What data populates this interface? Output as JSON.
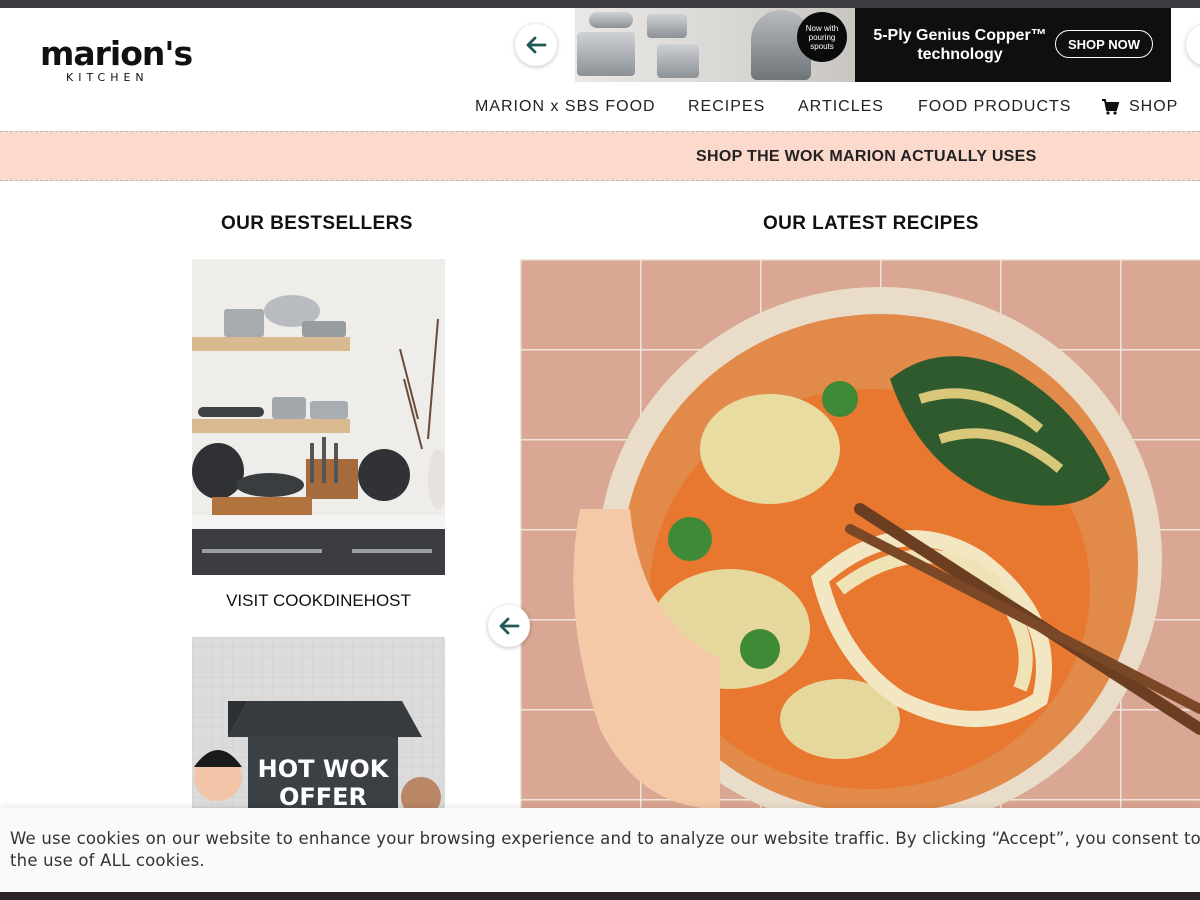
{
  "brand": {
    "name": "marion's",
    "subtitle": "KITCHEN"
  },
  "ad": {
    "badge": "Now with pouring spouts",
    "headline": "5-Ply Genius Copper™ technology",
    "cta": "SHOP NOW"
  },
  "nav": {
    "items": [
      "MARION x SBS FOOD",
      "RECIPES",
      "ARTICLES",
      "FOOD PRODUCTS"
    ],
    "shop": "SHOP"
  },
  "promo": {
    "text": "SHOP THE WOK MARION ACTUALLY USES"
  },
  "bestsellers": {
    "heading": "OUR BESTSELLERS",
    "visit_link": "VISIT COOKDINEHOST",
    "offer_text": [
      "HOT WOK",
      "OFFER"
    ]
  },
  "recipes": {
    "heading": "OUR LATEST RECIPES"
  },
  "cookie": {
    "text": "We use cookies on our website to enhance your browsing experience and to analyze our website traffic. By clicking “Accept”, you consent to the use of ALL cookies."
  },
  "colors": {
    "promo_bg": "#fbd9cd",
    "arrow": "#1f5a57",
    "ad_bg": "#0f0f0f"
  },
  "icons": [
    "arrow-left-icon",
    "cart-icon"
  ]
}
